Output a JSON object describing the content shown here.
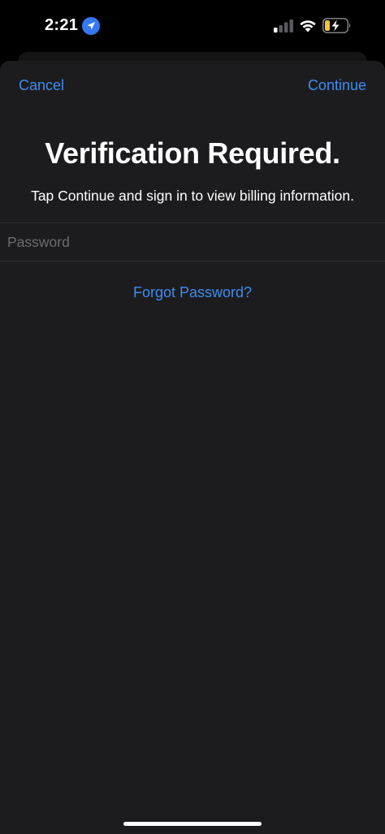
{
  "status_bar": {
    "time": "2:21",
    "location_icon": "location-arrow-icon",
    "signal_icon": "cellular-signal-icon",
    "wifi_icon": "wifi-icon",
    "battery_icon": "battery-charging-icon"
  },
  "nav": {
    "cancel_label": "Cancel",
    "continue_label": "Continue"
  },
  "main": {
    "title": "Verification Required.",
    "subtitle": "Tap Continue and sign in to view billing information.",
    "password_placeholder": "Password",
    "password_value": "",
    "forgot_label": "Forgot Password?"
  },
  "colors": {
    "accent": "#3d8cf0",
    "sheet_background": "#1c1c1e",
    "location_badge": "#3478f6",
    "battery_fill": "#f5c242"
  }
}
